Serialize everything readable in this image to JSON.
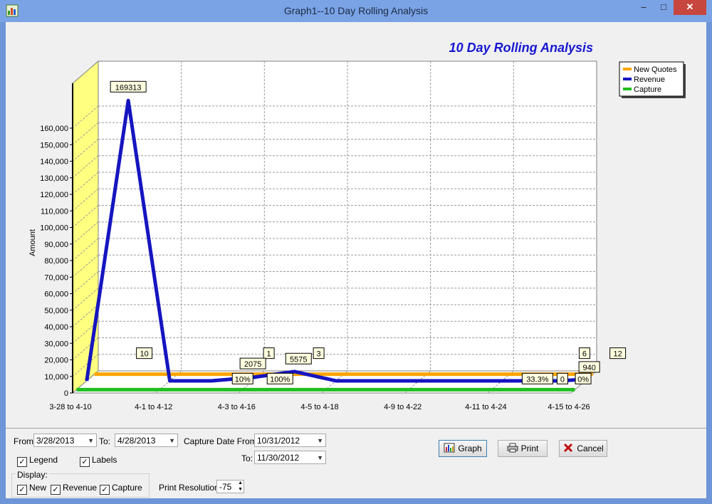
{
  "window": {
    "title": "Graph1--10 Day Rolling Analysis",
    "min_glyph": "–",
    "max_glyph": "□",
    "close_glyph": "✕"
  },
  "chart_data": {
    "type": "line",
    "title": "10 Day Rolling Analysis",
    "ylabel": "Amount",
    "xlabel": "",
    "ylim": [
      0,
      160000
    ],
    "yticks": [
      "0",
      "10,000",
      "20,000",
      "30,000",
      "40,000",
      "50,000",
      "60,000",
      "70,000",
      "80,000",
      "90,000",
      "100,000",
      "110,000",
      "120,000",
      "130,000",
      "140,000",
      "150,000",
      "160,000"
    ],
    "categories": [
      "3-28 to 4-10",
      "4-1 to 4-12",
      "4-3 to 4-16",
      "4-5 to 4-18",
      "4-9 to 4-22",
      "4-11 to 4-24",
      "4-15 to 4-26"
    ],
    "grid": true,
    "legend": "top-right",
    "series": [
      {
        "name": "New Quotes",
        "color": "#ffa500",
        "x": [
          0,
          1,
          2,
          3,
          4,
          5,
          6
        ],
        "values": [
          10,
          10,
          1,
          3,
          3,
          6,
          12
        ],
        "labels": [
          {
            "x": 0.6,
            "text": "10"
          },
          {
            "x": 2.1,
            "text": "1"
          },
          {
            "x": 2.7,
            "text": "3"
          },
          {
            "x": 5.9,
            "text": "6"
          },
          {
            "x": 6.3,
            "text": "12"
          }
        ]
      },
      {
        "name": "Revenue",
        "color": "#1515c0",
        "x": [
          0,
          0.5,
          1,
          1.5,
          2,
          2.5,
          3,
          4,
          5,
          5.7,
          6
        ],
        "values": [
          0,
          169313,
          0,
          0,
          2075,
          5575,
          0,
          0,
          0,
          0,
          940
        ],
        "labels": [
          {
            "x": 0.5,
            "text": "169313"
          },
          {
            "x": 2.0,
            "text": "2075"
          },
          {
            "x": 2.55,
            "text": "5575"
          },
          {
            "x": 6.05,
            "text": "940"
          }
        ]
      },
      {
        "name": "Capture",
        "color": "#1fbf1f",
        "x": [
          0,
          1,
          2,
          3,
          4,
          5,
          6
        ],
        "values": [
          0,
          0,
          0,
          0,
          0,
          0,
          0
        ],
        "labels": [
          {
            "x": 2.0,
            "text": "10%"
          },
          {
            "x": 2.45,
            "text": "100%"
          },
          {
            "x": 5.55,
            "text": "33.3%"
          },
          {
            "x": 5.85,
            "text": "0"
          },
          {
            "x": 6.1,
            "text": "0%"
          }
        ]
      }
    ]
  },
  "controls": {
    "from_label": "From:",
    "from_value": "3/28/2013",
    "to_label": "To:",
    "to_value": "4/28/2013",
    "capture_from_label": "Capture Date From:",
    "capture_from_value": "10/31/2012",
    "capture_to_label": "To:",
    "capture_to_value": "11/30/2012",
    "legend_label": "Legend",
    "labels_label": "Labels",
    "display_label": "Display:",
    "new_label": "New",
    "revenue_label": "Revenue",
    "capture_label": "Capture",
    "print_resolution_label": "Print Resolution:",
    "print_resolution_value": "-75",
    "check_glyph": "✓",
    "dropdown_glyph": "▼",
    "spin_up_glyph": "▲",
    "spin_down_glyph": "▼"
  },
  "buttons": {
    "graph": "Graph",
    "print": "Print",
    "cancel": "Cancel"
  }
}
